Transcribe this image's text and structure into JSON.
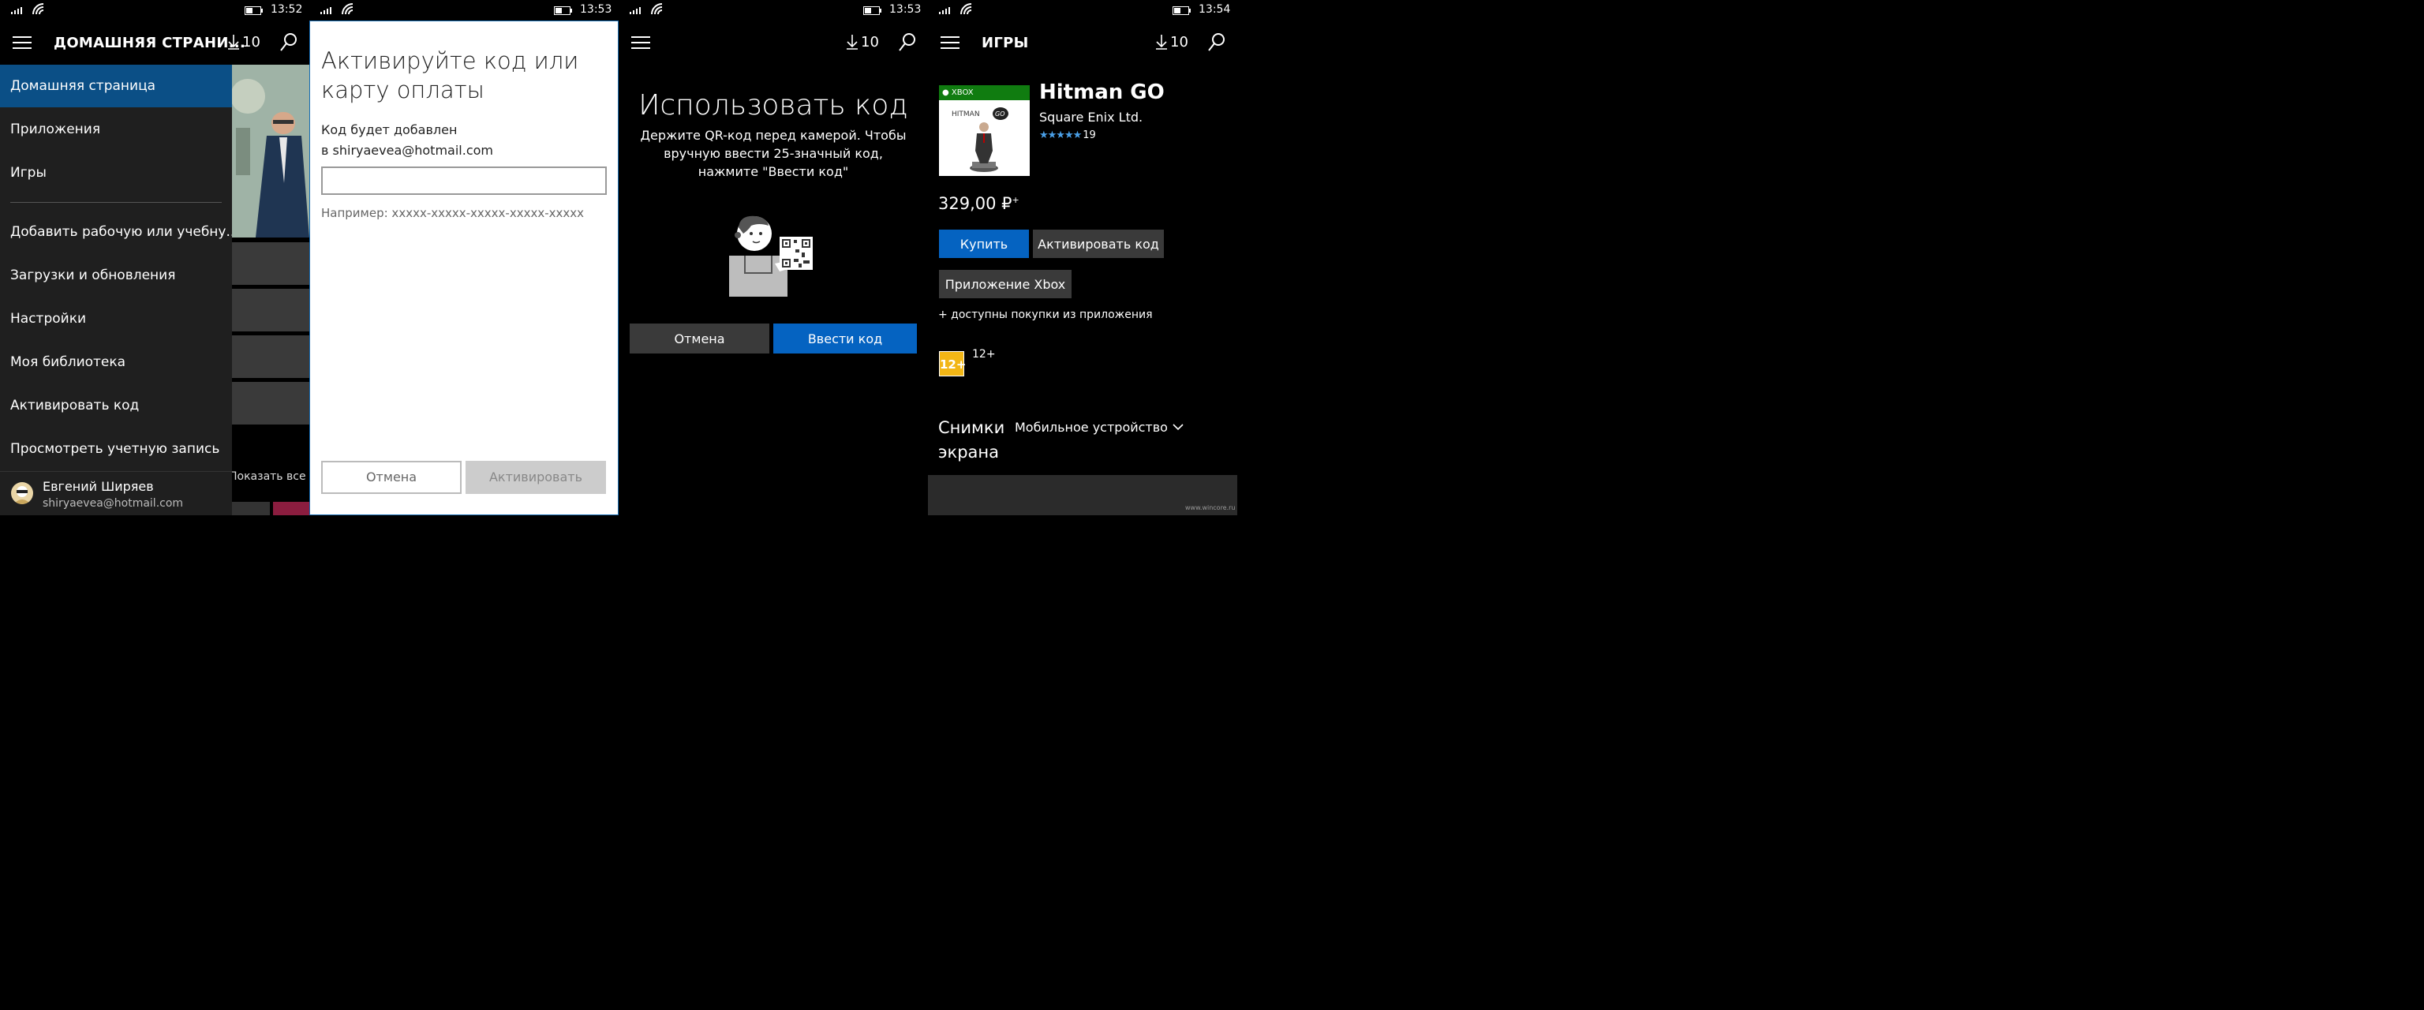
{
  "panel1": {
    "status": {
      "time": "13:52"
    },
    "appbar": {
      "title": "ДОМАШНЯЯ СТРАНИ...",
      "downloads": "10"
    },
    "menu": {
      "items": [
        {
          "label": "Домашняя страница"
        },
        {
          "label": "Приложения"
        },
        {
          "label": "Игры"
        },
        {
          "label": "Добавить рабочую или учебну..."
        },
        {
          "label": "Загрузки и обновления"
        },
        {
          "label": "Настройки"
        },
        {
          "label": "Моя библиотека"
        },
        {
          "label": "Активировать код"
        },
        {
          "label": "Просмотреть учетную запись"
        }
      ]
    },
    "user": {
      "name": "Евгений Ширяев",
      "email": "shiryaevea@hotmail.com"
    },
    "show_all": "Показать все"
  },
  "panel2": {
    "status": {
      "time": "13:53"
    },
    "dialog": {
      "title": "Активируйте код или карту оплаты",
      "line1": "Код будет добавлен",
      "line2": "в shiryaevea@hotmail.com",
      "input_value": "",
      "hint": "Например: xxxxx-xxxxx-xxxxx-xxxxx-xxxxx",
      "cancel": "Отмена",
      "activate": "Активировать"
    }
  },
  "panel3": {
    "status": {
      "time": "13:53"
    },
    "appbar": {
      "downloads": "10"
    },
    "title": "Использовать код",
    "description": "Держите QR-код перед камерой. Чтобы вручную ввести 25-значный код, нажмите \"Ввести код\"",
    "cancel": "Отмена",
    "enter_code": "Ввести код"
  },
  "panel4": {
    "status": {
      "time": "13:54"
    },
    "appbar": {
      "title": "ИГРЫ",
      "downloads": "10"
    },
    "game": {
      "box_brand": "XBOX",
      "box_title": "HITMAN",
      "box_badge": "GO",
      "title": "Hitman GO",
      "publisher": "Square Enix Ltd.",
      "stars": "★★★★★",
      "rating_count": "19",
      "price": "329,00 ₽",
      "price_mark": "+",
      "buy": "Купить",
      "activate_code": "Активировать код",
      "xbox_app": "Приложение Xbox",
      "iap": "+ доступны покупки из приложения",
      "age_badge": "12+",
      "age_label": "12+",
      "screenshots_label": "Снимки экрана",
      "device": "Мобильное устройство"
    },
    "watermark": "www.wincore.ru"
  },
  "colors": {
    "accent": "#0563c1",
    "menu_active": "#0b4f86",
    "xbox_green": "#107c10",
    "age_yellow": "#f2b615"
  }
}
